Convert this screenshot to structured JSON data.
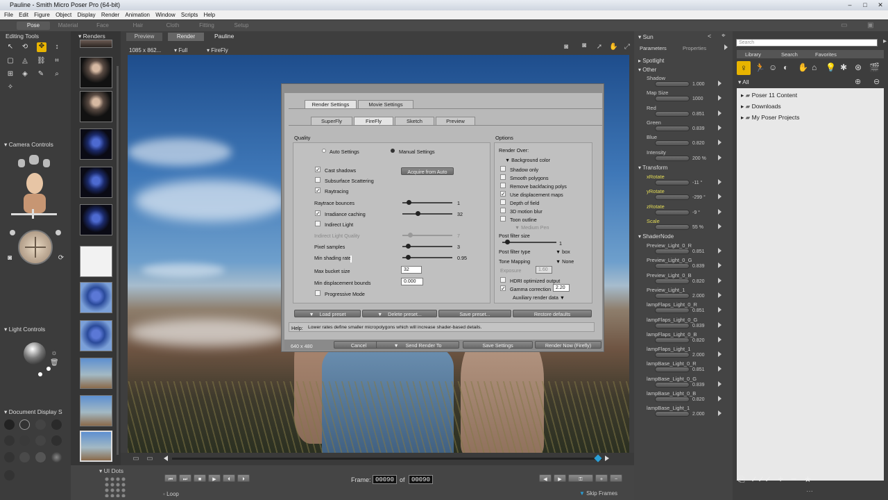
{
  "window": {
    "title": "Pauline - Smith Micro Poser Pro  (64-bit)"
  },
  "menu": [
    "File",
    "Edit",
    "Figure",
    "Object",
    "Display",
    "Render",
    "Animation",
    "Window",
    "Scripts",
    "Help"
  ],
  "rooms": [
    "Pose",
    "Material",
    "Face",
    "Hair",
    "Cloth",
    "Fitting",
    "Setup"
  ],
  "left": {
    "editing_tools": "Editing Tools",
    "camera_controls": "Camera Controls",
    "light_controls": "Light Controls",
    "document_display": "Document Display S",
    "ui_dots": "UI Dots"
  },
  "renders": {
    "title": "Renders"
  },
  "viewport": {
    "tabs": [
      "Preview",
      "Render",
      "Pauline"
    ],
    "size": "1085 x 862...",
    "fill": "Full",
    "renderer": "FireFly"
  },
  "dialog": {
    "top_tabs": [
      "Render Settings",
      "Movie Settings"
    ],
    "sub_tabs": [
      "SuperFly",
      "FireFly",
      "Sketch",
      "Preview"
    ],
    "quality_title": "Quality",
    "auto_settings": "Auto Settings",
    "manual_settings": "Manual Settings",
    "cast_shadows": "Cast shadows",
    "acquire": "Acquire from Auto",
    "subsurface": "Subsurface Scattering",
    "raytracing": "Raytracing",
    "raytrace_bounces": "Raytrace bounces",
    "raytrace_bounces_val": "1",
    "irradiance": "Irradiance caching",
    "irradiance_val": "32",
    "indirect_light": "Indirect Light",
    "indirect_quality": "Indirect Light Quality",
    "indirect_quality_val": "7",
    "pixel_samples": "Pixel samples",
    "pixel_samples_val": "3",
    "min_shading": "Min shading rate",
    "min_shading_val": "0.95",
    "max_bucket": "Max bucket size",
    "max_bucket_val": "32",
    "min_disp": "Min displacement bounds",
    "min_disp_val": "0.000",
    "progressive": "Progressive Mode",
    "options_title": "Options",
    "render_over": "Render Over:",
    "background_color": "Background color",
    "shadow_only": "Shadow only",
    "smooth_polygons": "Smooth polygons",
    "remove_backfacing": "Remove backfacing polys",
    "use_displacement": "Use displacement maps",
    "depth_of_field": "Depth of field",
    "motion_blur": "3D motion blur",
    "toon_outline": "Toon outline",
    "medium_pen": "Medium Pen",
    "post_filter_size": "Post filter size",
    "post_filter_size_val": "1",
    "post_filter_type": "Post filter type",
    "post_filter_type_val": "box",
    "tone_mapping": "Tone Mapping",
    "tone_mapping_val": "None",
    "exposure": "Exposure",
    "exposure_val": "1.60",
    "hdri": "HDRI optimized output",
    "gamma": "Gamma correction",
    "gamma_val": "2.20",
    "aux": "Auxiliary render data",
    "load_preset": "Load preset",
    "delete_preset": "Delete preset...",
    "save_preset": "Save preset...",
    "restore_defaults": "Restore defaults",
    "help_label": "Help:",
    "help_text": "Lower rates define smaller micropolygons which will increase shader-based details.",
    "size": "640 x 480",
    "cancel": "Cancel",
    "send_render": "Send Render To",
    "save_settings": "Save Settings",
    "render_now": "Render Now (Firefly)"
  },
  "timeline": {
    "frame_label": "Frame:",
    "frame": "00090",
    "of": "of",
    "total": "00090",
    "loop": "Loop",
    "skip": "Skip Frames"
  },
  "params": {
    "title": "Sun",
    "tabs": [
      "Parameters",
      "Properties"
    ],
    "spotlight": "Spotlight",
    "other": "Other",
    "items": [
      {
        "label": "Shadow",
        "value": "1.000"
      },
      {
        "label": "Map Size",
        "value": "1000"
      },
      {
        "label": "Red",
        "value": "0.851"
      },
      {
        "label": "Green",
        "value": "0.839"
      },
      {
        "label": "Blue",
        "value": "0.820"
      },
      {
        "label": "Intensity",
        "value": "200 %"
      }
    ],
    "transform": "Transform",
    "transform_items": [
      {
        "label": "xRotate",
        "value": "-11 °"
      },
      {
        "label": "yRotate",
        "value": "-299 °"
      },
      {
        "label": "zRotate",
        "value": "-9 °"
      },
      {
        "label": "Scale",
        "value": "55 %"
      }
    ],
    "shadernode": "ShaderNode",
    "shader_items": [
      {
        "label": "Preview_Light_0_R",
        "value": "0.851"
      },
      {
        "label": "Preview_Light_0_G",
        "value": "0.839"
      },
      {
        "label": "Preview_Light_0_B",
        "value": "0.820"
      },
      {
        "label": "Preview_Light_1",
        "value": "2.000"
      },
      {
        "label": "lampFlaps_Light_0_R",
        "value": "0.851"
      },
      {
        "label": "lampFlaps_Light_0_G",
        "value": "0.839"
      },
      {
        "label": "lampFlaps_Light_0_B",
        "value": "0.820"
      },
      {
        "label": "lampFlaps_Light_1",
        "value": "2.000"
      },
      {
        "label": "lampBase_Light_0_R",
        "value": "0.851"
      },
      {
        "label": "lampBase_Light_0_G",
        "value": "0.839"
      },
      {
        "label": "lampBase_Light_0_B",
        "value": "0.820"
      },
      {
        "label": "lampBase_Light_1",
        "value": "2.000"
      }
    ]
  },
  "library": {
    "search_placeholder": "Search",
    "tabs": [
      "Library",
      "Search",
      "Favorites"
    ],
    "all": "All",
    "folders": [
      "Poser 11 Content",
      "Downloads",
      "My Poser Projects"
    ]
  }
}
